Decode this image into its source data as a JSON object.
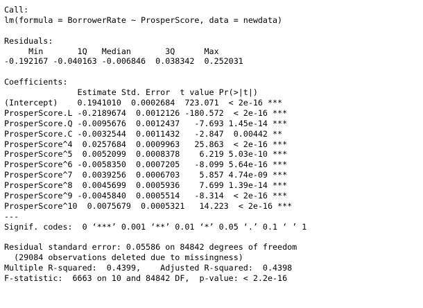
{
  "console": {
    "lines": [
      "Call:",
      "lm(formula = BorrowerRate ~ ProsperScore, data = newdata)",
      "",
      "Residuals:",
      "     Min       1Q   Median       3Q      Max ",
      "-0.192167 -0.040163 -0.006846  0.038342  0.252031 ",
      "",
      "Coefficients:",
      "               Estimate Std. Error  t value Pr(>|t|)    ",
      "(Intercept)    0.1941010  0.0002684  723.071  < 2e-16 ***",
      "ProsperScore.L -0.2189674  0.0012126 -180.572  < 2e-16 ***",
      "ProsperScore.Q -0.0095676  0.0012437   -7.693 1.45e-14 ***",
      "ProsperScore.C -0.0032544  0.0011432   -2.847  0.00442 ** ",
      "ProsperScore^4  0.0257684  0.0009963   25.863  < 2e-16 ***",
      "ProsperScore^5  0.0052099  0.0008378    6.219 5.03e-10 ***",
      "ProsperScore^6 -0.0058350  0.0007205   -8.099 5.64e-16 ***",
      "ProsperScore^7  0.0039256  0.0006703    5.857 4.74e-09 ***",
      "ProsperScore^8  0.0045699  0.0005936    7.699 1.39e-14 ***",
      "ProsperScore^9 -0.0045840  0.0005514   -8.314  < 2e-16 ***",
      "ProsperScore^10  0.0075679  0.0005321   14.223  < 2e-16 ***",
      "---",
      "Signif. codes:  0 ‘***’ 0.001 ‘**’ 0.01 ‘*’ 0.05 ‘.’ 0.1 ‘ ’ 1",
      "",
      "Residual standard error: 0.05586 on 84842 degrees of freedom",
      "  (29084 observations deleted due to missingness)",
      "Multiple R-squared:  0.4399,    Adjusted R-squared:  0.4398 ",
      "F-statistic:  6663 on 10 and 84842 DF,  p-value: < 2.2e-16"
    ]
  }
}
